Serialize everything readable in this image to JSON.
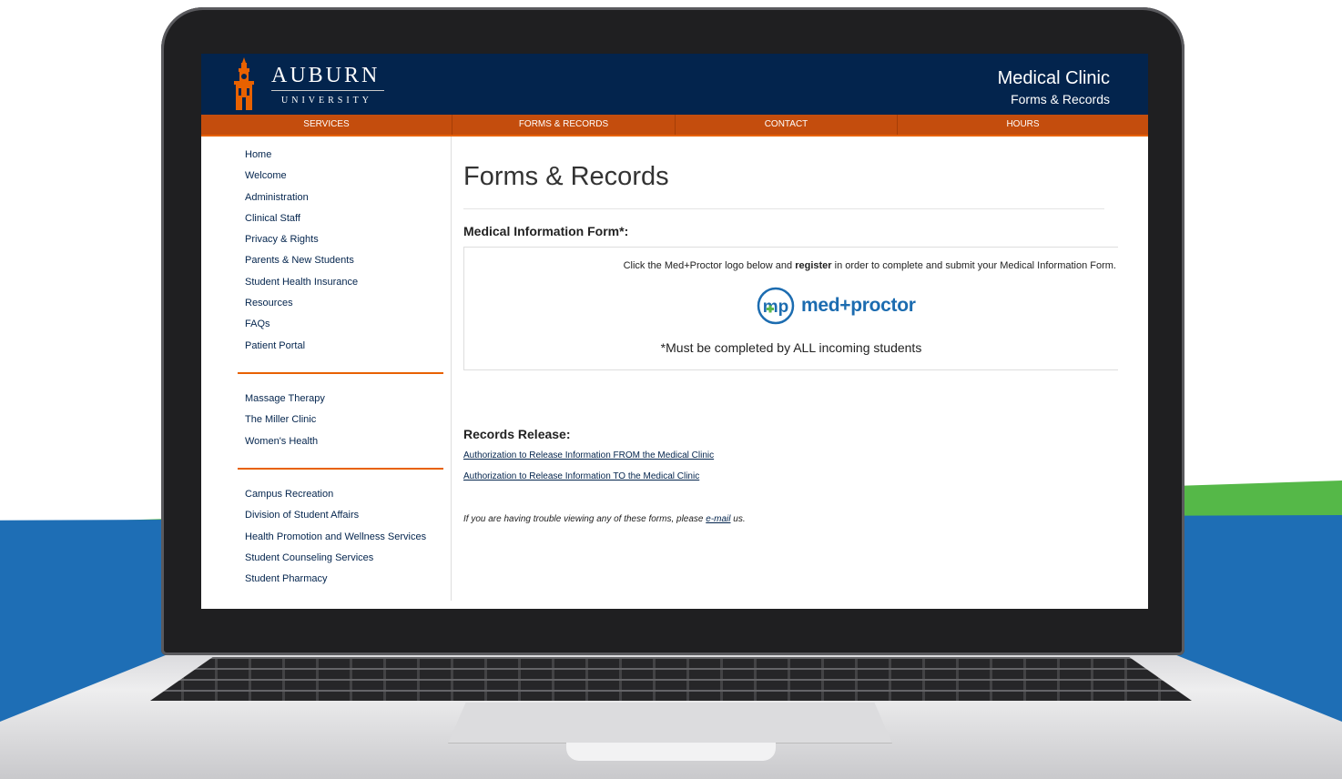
{
  "header": {
    "logo_word": "AUBURN",
    "logo_sub": "UNIVERSITY",
    "clinic_title": "Medical Clinic",
    "clinic_sub": "Forms & Records"
  },
  "nav": [
    "SERVICES",
    "FORMS & RECORDS",
    "CONTACT",
    "HOURS"
  ],
  "sidebar": {
    "group1": [
      "Home",
      "Welcome",
      "Administration",
      "Clinical Staff",
      "Privacy & Rights",
      "Parents & New Students",
      "Student Health Insurance",
      "Resources",
      "FAQs",
      "Patient Portal"
    ],
    "group2": [
      "Massage Therapy",
      "The Miller Clinic",
      "Women's Health"
    ],
    "group3": [
      "Campus Recreation",
      "Division of Student Affairs",
      "Health Promotion and Wellness Services",
      "Student Counseling Services",
      "Student Pharmacy"
    ]
  },
  "main": {
    "title": "Forms & Records",
    "med_form_heading": "Medical Information Form*:",
    "instr_before": "Click the Med+Proctor logo below and ",
    "instr_bold": "register",
    "instr_after": " in order to complete and submit your Medical Information Form.",
    "logo_text": "med+proctor",
    "logo_mono": "mp",
    "must_note": "*Must be completed by ALL incoming students",
    "records_heading": "Records Release:",
    "link_from": "Authorization to Release Information FROM the Medical Clinic",
    "link_to": "Authorization to Release Information TO the Medical Clinic",
    "trouble_before": "If you are having trouble viewing any of these forms, please ",
    "trouble_link": "e-mail",
    "trouble_after": " us."
  },
  "colors": {
    "navy": "#03244d",
    "orange": "#c44d0d",
    "orange_accent": "#e86100",
    "bg_blue": "#1e6eb5",
    "bg_green": "#55b848",
    "medproctor_blue": "#1c6cb0",
    "medproctor_green": "#5cb84b"
  }
}
